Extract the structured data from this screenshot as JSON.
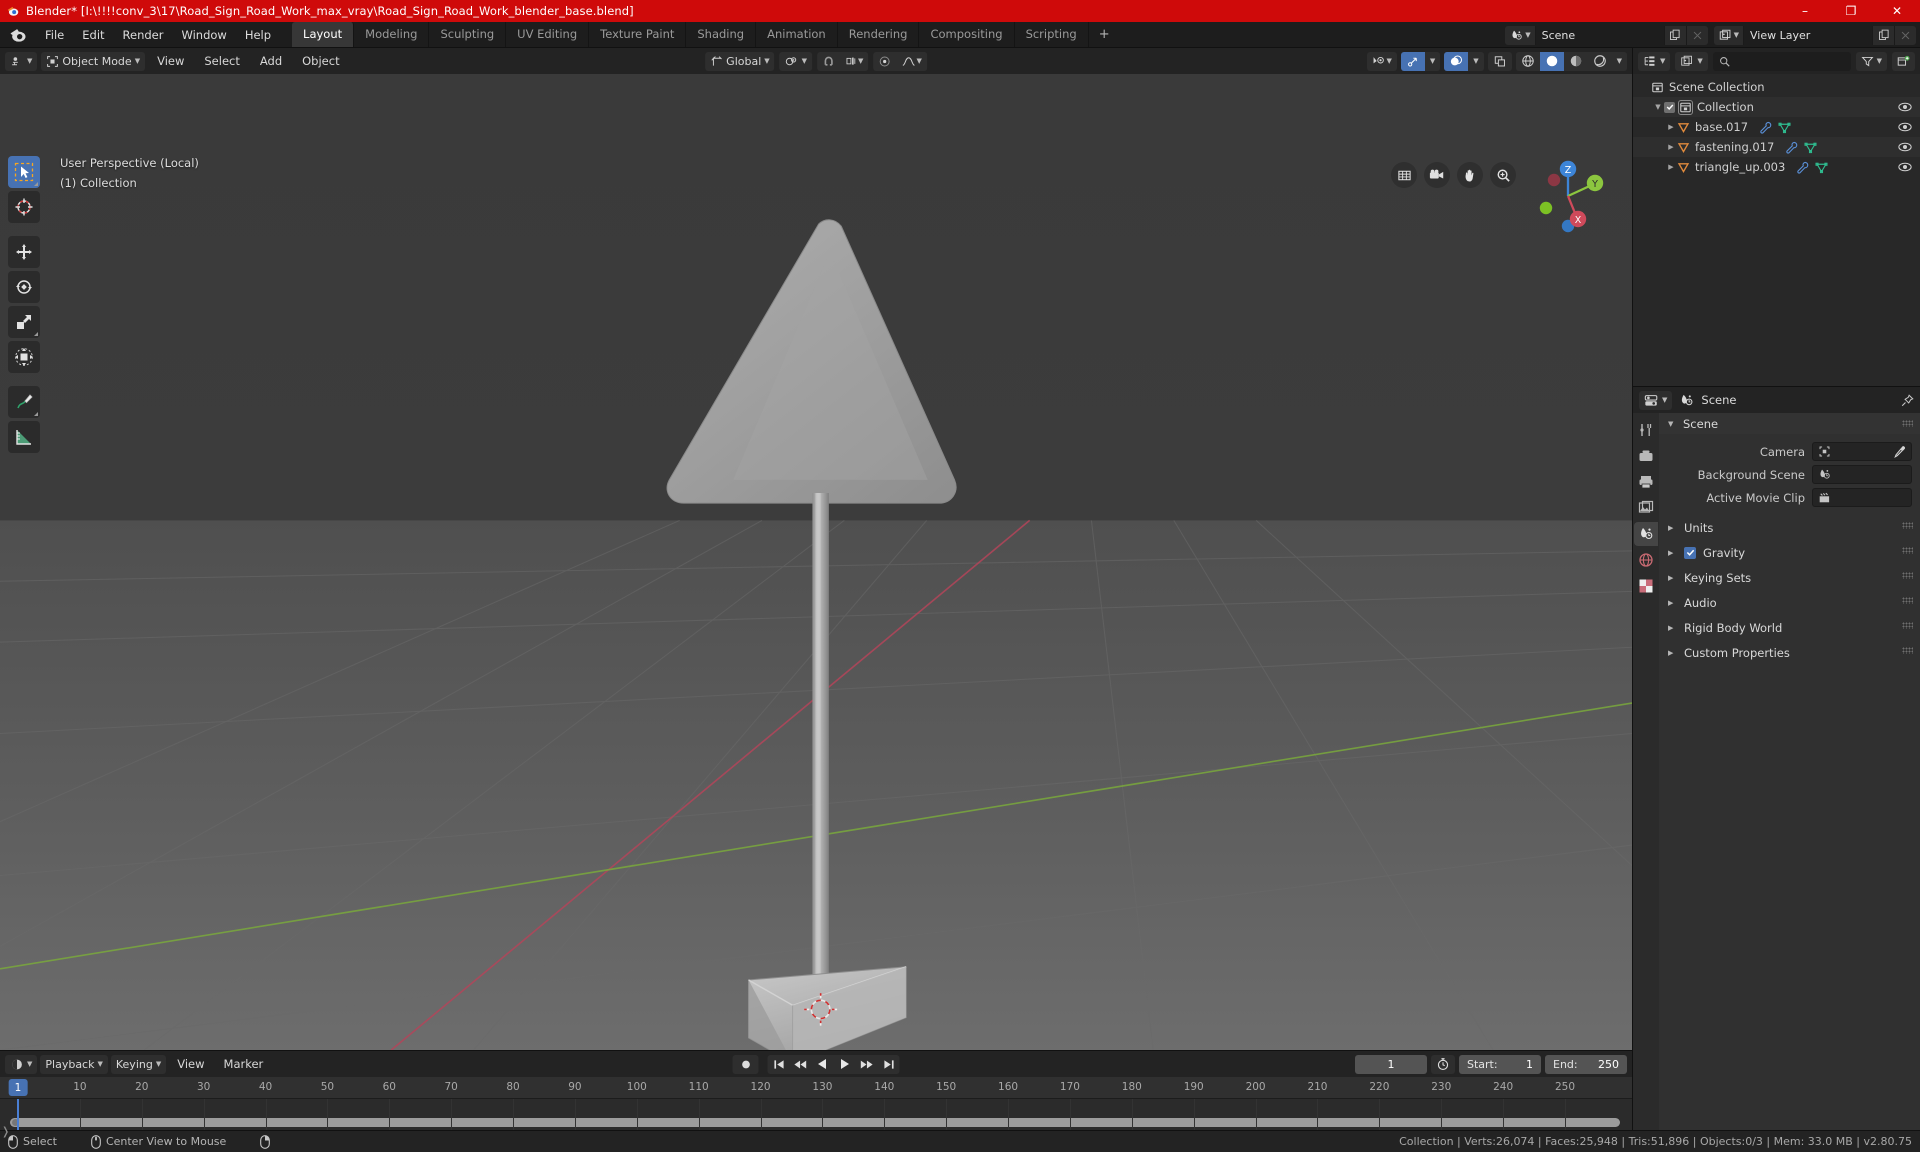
{
  "window": {
    "title": "Blender* [I:\\!!!!conv_3\\17\\Road_Sign_Road_Work_max_vray\\Road_Sign_Road_Work_blender_base.blend]",
    "minimize_label": "–",
    "maximize_label": "❐",
    "close_label": "✕"
  },
  "topbar": {
    "menus": [
      "File",
      "Edit",
      "Render",
      "Window",
      "Help"
    ],
    "workspaces": [
      {
        "label": "Layout",
        "active": true
      },
      {
        "label": "Modeling",
        "active": false
      },
      {
        "label": "Sculpting",
        "active": false
      },
      {
        "label": "UV Editing",
        "active": false
      },
      {
        "label": "Texture Paint",
        "active": false
      },
      {
        "label": "Shading",
        "active": false
      },
      {
        "label": "Animation",
        "active": false
      },
      {
        "label": "Rendering",
        "active": false
      },
      {
        "label": "Compositing",
        "active": false
      },
      {
        "label": "Scripting",
        "active": false
      }
    ],
    "add_workspace": "+",
    "scene_name": "Scene",
    "view_layer_name": "View Layer"
  },
  "viewport_header": {
    "mode": "Object Mode",
    "menus": [
      "View",
      "Select",
      "Add",
      "Object"
    ],
    "transform_orientation": "Global"
  },
  "viewport": {
    "overlay_line1": "User Perspective (Local)",
    "overlay_line2": "(1) Collection",
    "gizmo_axes": [
      "Z",
      "Y",
      "X"
    ],
    "tools": [
      "tweak-select-tool",
      "cursor-tool",
      "move-tool",
      "rotate-tool",
      "scale-tool",
      "transform-tool",
      "annotate-tool",
      "measure-tool"
    ],
    "nav_buttons": [
      "toggle-camera-perspective",
      "camera-view",
      "pan-view",
      "zoom-view"
    ]
  },
  "outliner": {
    "header_icons": [
      "display-mode-icon",
      "filter-id-icon",
      "search-icon",
      "filter-icon",
      "new-collection-icon"
    ],
    "search_placeholder": "",
    "rows": [
      {
        "name": "Scene Collection",
        "type": "scene-collection",
        "indent": 0,
        "expand": "",
        "checkbox": false,
        "eye": false,
        "icons": []
      },
      {
        "name": "Collection",
        "type": "collection",
        "indent": 1,
        "expand": "▼",
        "checkbox": true,
        "eye": true,
        "icons": []
      },
      {
        "name": "base.017",
        "type": "object",
        "indent": 2,
        "expand": "▶",
        "checkbox": false,
        "eye": true,
        "icons": [
          "modifier-icon",
          "mesh-data-icon"
        ]
      },
      {
        "name": "fastening.017",
        "type": "object",
        "indent": 2,
        "expand": "▶",
        "checkbox": false,
        "eye": true,
        "icons": [
          "modifier-icon",
          "mesh-data-icon"
        ]
      },
      {
        "name": "triangle_up.003",
        "type": "object",
        "indent": 2,
        "expand": "▶",
        "checkbox": false,
        "eye": true,
        "icons": [
          "modifier-icon",
          "mesh-data-icon"
        ]
      }
    ]
  },
  "properties": {
    "breadcrumb": "Scene",
    "tabs": [
      "tool-tab",
      "render-tab",
      "output-tab",
      "view-layer-tab",
      "scene-tab",
      "world-tab",
      "texture-tab"
    ],
    "active_tab_index": 4,
    "panels": [
      {
        "label": "Scene",
        "open": true
      },
      {
        "label": "Units",
        "open": false
      },
      {
        "label": "Gravity",
        "open": false,
        "checkbox": true
      },
      {
        "label": "Keying Sets",
        "open": false
      },
      {
        "label": "Audio",
        "open": false
      },
      {
        "label": "Rigid Body World",
        "open": false
      },
      {
        "label": "Custom Properties",
        "open": false
      }
    ],
    "scene_fields": [
      {
        "label": "Camera",
        "value": "",
        "icon": "camera-icon",
        "eyedropper": true
      },
      {
        "label": "Background Scene",
        "value": "",
        "icon": "scene-icon",
        "eyedropper": false
      },
      {
        "label": "Active Movie Clip",
        "value": "",
        "icon": "clip-icon",
        "eyedropper": false
      }
    ]
  },
  "timeline": {
    "menus": [
      "Playback",
      "Keying",
      "View",
      "Marker"
    ],
    "current_frame": "1",
    "start_label": "Start:",
    "start_value": "1",
    "end_label": "End:",
    "end_value": "250",
    "ticks": [
      "1",
      "10",
      "20",
      "30",
      "40",
      "50",
      "60",
      "70",
      "80",
      "90",
      "100",
      "110",
      "120",
      "130",
      "140",
      "150",
      "160",
      "170",
      "180",
      "190",
      "200",
      "210",
      "220",
      "230",
      "240",
      "250"
    ]
  },
  "statusbar": {
    "items": [
      {
        "icon": "mouse-left-icon",
        "label": "Select"
      },
      {
        "icon": "mouse-middle-icon",
        "label": "Center View to Mouse"
      },
      {
        "icon": "mouse-right-icon",
        "label": ""
      }
    ],
    "stats": "Collection | Verts:26,074 | Faces:25,948 | Tris:51,896 | Objects:0/3 | Mem: 33.0 MB | v2.80.75"
  },
  "colors": {
    "title_bar": "#cf0a0a",
    "accent": "#4772b3",
    "axis_x": "#cf4a5b",
    "axis_y": "#8cc63f",
    "axis_z": "#3d85d8"
  }
}
